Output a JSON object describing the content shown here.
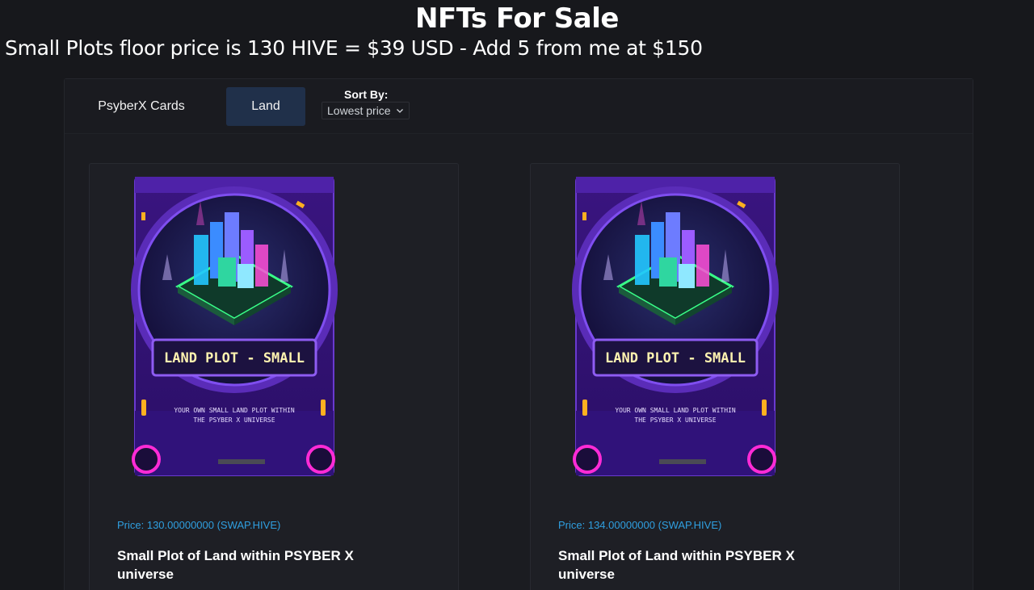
{
  "page": {
    "title": "NFTs For Sale",
    "subtitle": "Small Plots floor price is 130 HIVE = $39 USD - Add 5 from me at $150"
  },
  "tabs": [
    {
      "label": "PsyberX Cards",
      "active": false
    },
    {
      "label": "Land",
      "active": true
    }
  ],
  "sort": {
    "label": "Sort By:",
    "selected": "Lowest price"
  },
  "listings": [
    {
      "price": "Price: 130.00000000 (SWAP.HIVE)",
      "title": "Small Plot of Land within PSYBER X universe",
      "image_banner": "LAND PLOT - SMALL",
      "image_caption_line1": "YOUR OWN SMALL LAND PLOT WITHIN",
      "image_caption_line2": "THE PSYBER X UNIVERSE"
    },
    {
      "price": "Price: 134.00000000 (SWAP.HIVE)",
      "title": "Small Plot of Land within PSYBER X universe",
      "image_banner": "LAND PLOT - SMALL",
      "image_caption_line1": "YOUR OWN SMALL LAND PLOT WITHIN",
      "image_caption_line2": "THE PSYBER X UNIVERSE"
    }
  ],
  "colors": {
    "background": "#17181c",
    "active_tab": "#20304a",
    "price_text": "#2f9fe0",
    "card_purple": "#4a1a8c",
    "neon_green": "#39ff88",
    "neon_pink": "#ff2bd6",
    "neon_orange": "#ffb020"
  }
}
